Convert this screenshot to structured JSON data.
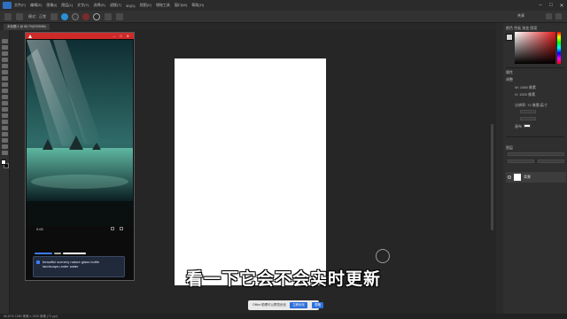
{
  "menu": {
    "items": [
      "文件(F)",
      "编辑(E)",
      "图像(I)",
      "图层(L)",
      "文字(Y)",
      "选择(S)",
      "滤镜(T)",
      "3D(D)",
      "视图(V)",
      "增效工具",
      "窗口(W)",
      "帮助(H)"
    ]
  },
  "options": {
    "mode_label": "模式：正常",
    "share_label": "共享"
  },
  "document_tab": {
    "label": "未标题-1 @ 66.7%(RGB/8#)"
  },
  "phone_window": {
    "time": "0:00",
    "prompt": "beautiful scenery nature glass bottle landscape,under water"
  },
  "right_panel": {
    "tabs": "颜色  色板  渐变  图案",
    "properties_label": "属性",
    "adjust_label": "调整",
    "layers_label": "图层",
    "layer_name": "背景",
    "w_label": "W: 1080 像素",
    "h_label": "H: 1920 像素",
    "res_label": "分辨率: 72 像素/英寸",
    "canvas_label": "画布"
  },
  "status": {
    "zoom": "66.67%   1080 像素 x 1920 像素 (72 ppi)"
  },
  "notice": {
    "text": "Office 助理可以帮您优化",
    "btn1": "立即优化",
    "btn2": "忽略"
  },
  "subtitle": {
    "text": "看一下它会不会实时更新"
  },
  "colors": {
    "accent": "#cf2a2a",
    "canvas": "#262626",
    "document": "#ffffff"
  }
}
